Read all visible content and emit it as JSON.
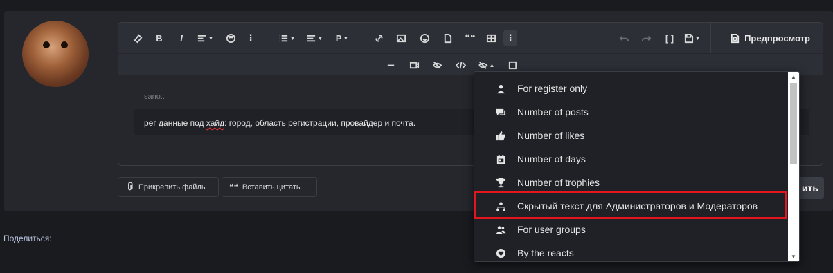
{
  "toolbar": {
    "preview_label": "Предпросмотр",
    "paragraph_label": "P"
  },
  "quote": {
    "author": "sano.:",
    "text_before": "рег данные под ",
    "text_misspelled": "хайд",
    "text_after": ": город, область регистрации, провайдер и почта."
  },
  "buttons": {
    "attach_files": "Прикрепить файлы",
    "insert_quotes": "Вставить цитаты...",
    "submit_partial": "ить"
  },
  "share_label": "Поделиться:",
  "dropdown": {
    "items": [
      {
        "label": "For register only",
        "icon": "user-icon"
      },
      {
        "label": "Number of posts",
        "icon": "comments-icon"
      },
      {
        "label": "Number of likes",
        "icon": "thumbs-up-icon"
      },
      {
        "label": "Number of days",
        "icon": "calendar-icon"
      },
      {
        "label": "Number of trophies",
        "icon": "trophy-icon"
      },
      {
        "label": "Скрытый текст для Администраторов и Модераторов",
        "icon": "user-hierarchy-icon"
      },
      {
        "label": "For user groups",
        "icon": "users-icon"
      },
      {
        "label": "By the reacts",
        "icon": "heart-icon"
      }
    ],
    "highlighted_item": "Скрытый текст для Администраторов и Модераторов"
  },
  "colors": {
    "background": "#1a1b1f",
    "panel": "#25272d",
    "highlight_border": "#e3161e",
    "share_text": "#b8c4de"
  }
}
